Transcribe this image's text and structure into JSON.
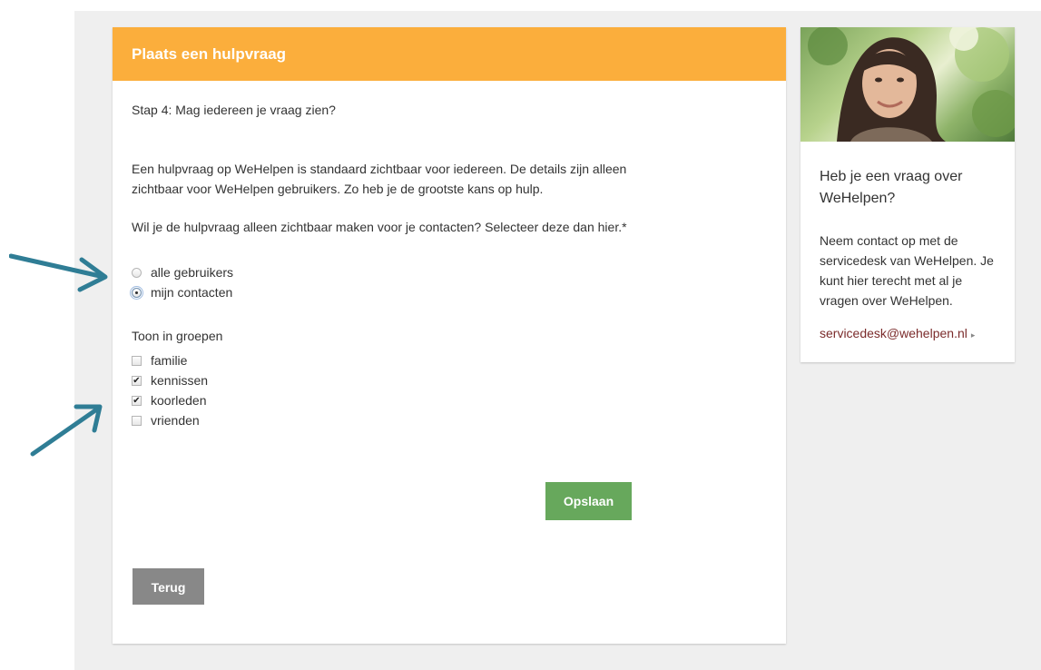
{
  "card": {
    "title": "Plaats een hulpvraag",
    "step": "Stap 4: Mag iedereen je vraag zien?",
    "paragraph1": "Een hulpvraag op WeHelpen is standaard zichtbaar voor iedereen. De details zijn alleen zichtbaar voor WeHelpen gebruikers. Zo heb je de grootste kans op hulp.",
    "paragraph2": "Wil je de hulpvraag alleen zichtbaar maken voor je contacten? Selecteer deze dan hier.*",
    "visibility_options": [
      {
        "label": "alle gebruikers",
        "checked": false
      },
      {
        "label": "mijn contacten",
        "checked": true
      }
    ],
    "groups_title": "Toon in groepen",
    "groups": [
      {
        "label": "familie",
        "checked": false
      },
      {
        "label": "kennissen",
        "checked": true
      },
      {
        "label": "koorleden",
        "checked": true
      },
      {
        "label": "vrienden",
        "checked": false
      }
    ],
    "save_label": "Opslaan",
    "back_label": "Terug"
  },
  "sidebar": {
    "title": "Heb je een vraag over WeHelpen?",
    "text": "Neem contact op met de servicedesk van WeHelpen. Je kunt hier terecht met al je vragen over WeHelpen.",
    "link": "servicedesk@wehelpen.nl",
    "link_icon": "triangle-right-icon"
  },
  "colors": {
    "header": "#fbae3c",
    "save_button": "#67a85c",
    "back_button": "#888888",
    "annotation_arrows": "#2f7d95",
    "link": "#7b2b2b"
  }
}
